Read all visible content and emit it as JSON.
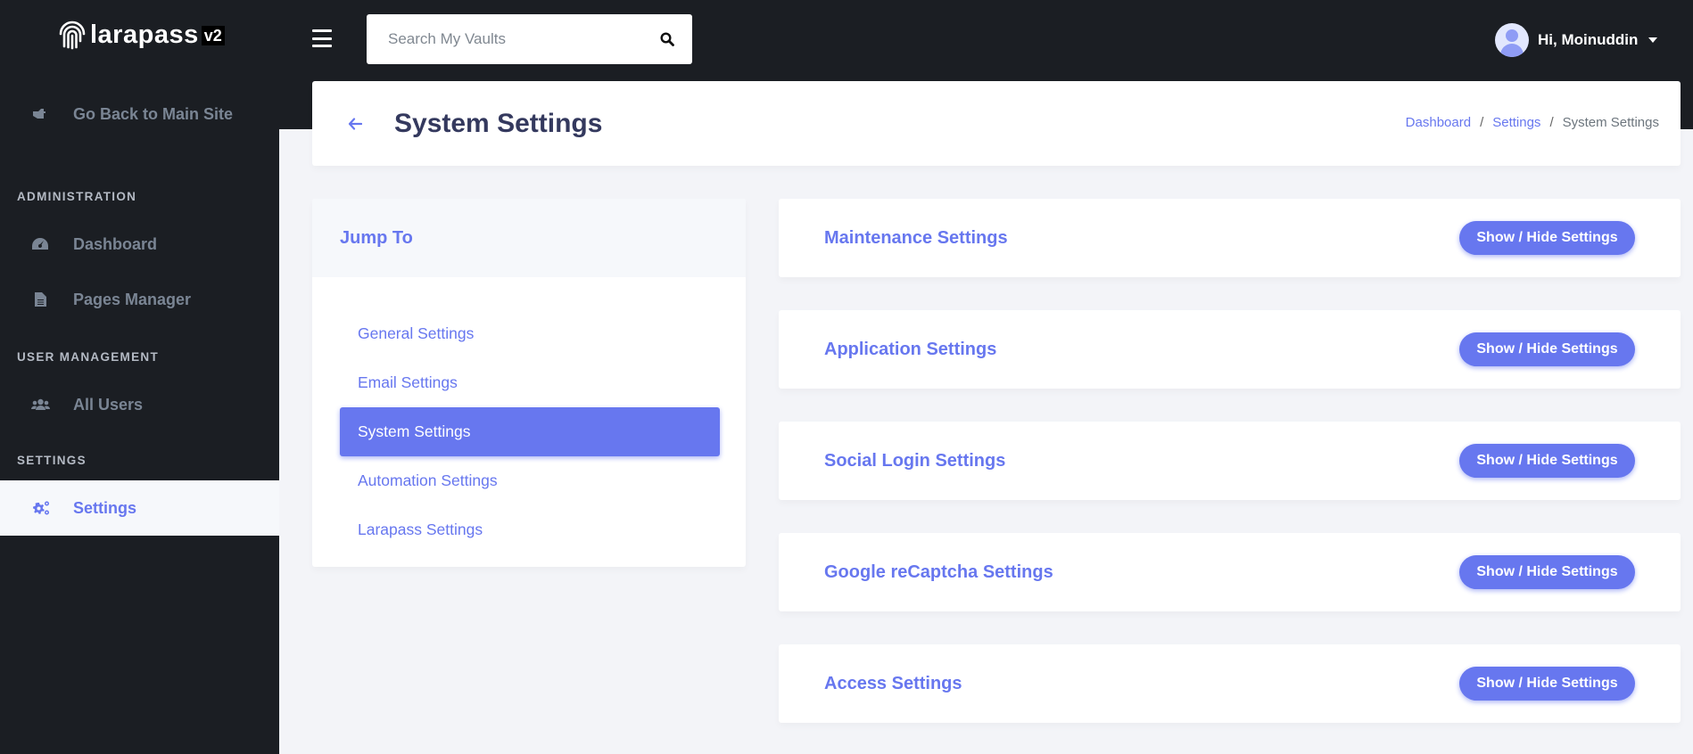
{
  "brand": {
    "name": "larapass",
    "version": "v2"
  },
  "header": {
    "search_placeholder": "Search My Vaults",
    "user_greeting": "Hi, Moinuddin"
  },
  "sidebar": {
    "back_link": "Go Back to Main Site",
    "sections": [
      {
        "heading": "Administration",
        "items": [
          {
            "label": "Dashboard",
            "icon": "tachometer-icon"
          },
          {
            "label": "Pages Manager",
            "icon": "file-icon"
          }
        ]
      },
      {
        "heading": "User Management",
        "items": [
          {
            "label": "All Users",
            "icon": "users-icon"
          }
        ]
      },
      {
        "heading": "Settings",
        "items": [
          {
            "label": "Settings",
            "icon": "cogs-icon",
            "active": true
          }
        ]
      }
    ]
  },
  "page": {
    "title": "System Settings",
    "breadcrumb": [
      "Dashboard",
      "Settings",
      "System Settings"
    ]
  },
  "jump_to": {
    "title": "Jump To",
    "items": [
      "General Settings",
      "Email Settings",
      "System Settings",
      "Automation Settings",
      "Larapass Settings"
    ],
    "active_index": 2
  },
  "settings_sections": [
    {
      "title": "Maintenance Settings",
      "button": "Show / Hide Settings"
    },
    {
      "title": "Application Settings",
      "button": "Show / Hide Settings"
    },
    {
      "title": "Social Login Settings",
      "button": "Show / Hide Settings"
    },
    {
      "title": "Google reCaptcha Settings",
      "button": "Show / Hide Settings"
    },
    {
      "title": "Access Settings",
      "button": "Show / Hide Settings"
    }
  ],
  "colors": {
    "primary": "#6777ef",
    "sidebar_bg": "#1b1e23",
    "page_bg": "#f3f4f8",
    "title_text": "#34395e"
  }
}
